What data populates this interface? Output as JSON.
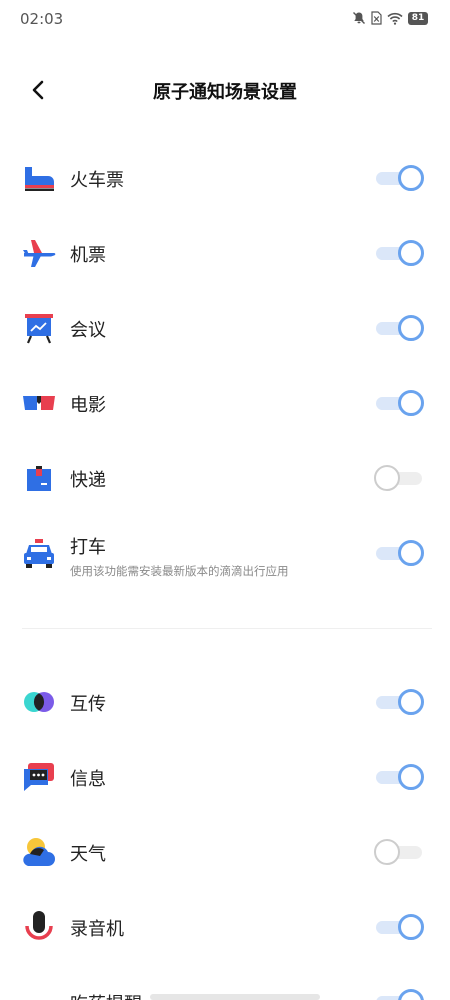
{
  "status_bar": {
    "time": "02:03",
    "battery": "81"
  },
  "header": {
    "title": "原子通知场景设置"
  },
  "colors": {
    "toggle_on": "#6aa3ee",
    "toggle_on_track": "#dbe7f9",
    "toggle_off": "#cdcdcd"
  },
  "items": [
    {
      "label": "火车票",
      "icon": "train-icon",
      "enabled": true
    },
    {
      "label": "机票",
      "icon": "airplane-icon",
      "enabled": true
    },
    {
      "label": "会议",
      "icon": "meeting-board-icon",
      "enabled": true
    },
    {
      "label": "电影",
      "icon": "3d-glasses-icon",
      "enabled": true
    },
    {
      "label": "快递",
      "icon": "package-icon",
      "enabled": false
    },
    {
      "label": "打车",
      "subtitle": "使用该功能需安装最新版本的滴滴出行应用",
      "icon": "taxi-icon",
      "enabled": true
    },
    {
      "label": "互传",
      "icon": "share-circles-icon",
      "enabled": true
    },
    {
      "label": "信息",
      "icon": "message-bubble-icon",
      "enabled": true
    },
    {
      "label": "天气",
      "icon": "weather-icon",
      "enabled": false
    },
    {
      "label": "录音机",
      "icon": "microphone-icon",
      "enabled": true
    },
    {
      "label": "吃药提醒",
      "icon": "reminder-icon",
      "enabled": true
    }
  ]
}
